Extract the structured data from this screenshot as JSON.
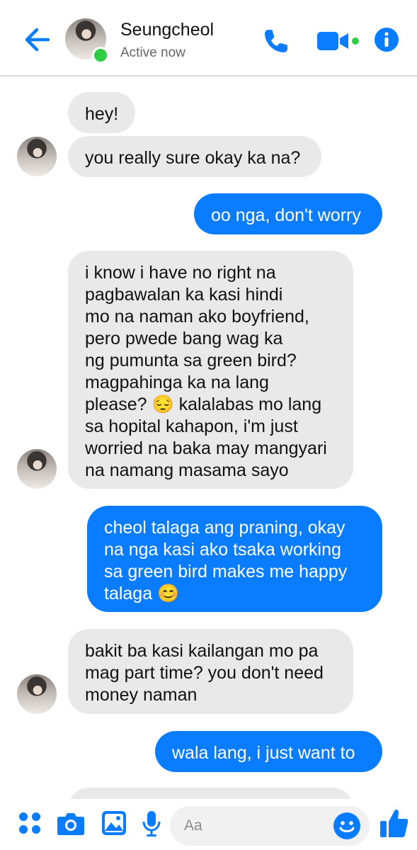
{
  "header": {
    "contact_name": "Seungcheol",
    "status": "Active now",
    "accent": "#0a7cff",
    "icons": [
      "back-arrow-icon",
      "phone-icon",
      "video-camera-icon",
      "info-icon"
    ]
  },
  "messages": [
    {
      "from": "them",
      "text": "hey!"
    },
    {
      "from": "them",
      "text": "you really sure okay ka na?"
    },
    {
      "from": "me",
      "text": "oo nga, don't worry"
    },
    {
      "from": "them",
      "text": "i know i have no right na\npagbawalan ka kasi hindi\nmo na naman ako boyfriend,\npero pwede bang wag ka\nng pumunta sa green bird?\nmagpahinga ka na lang\nplease? 😔 kalalabas mo lang\nsa hopital kahapon, i'm just\nworried na baka may mangyari\nna namang masama sayo"
    },
    {
      "from": "me",
      "text": "cheol talaga ang praning, okay\nna nga kasi ako tsaka working\nsa green bird makes me happy\ntalaga 😊"
    },
    {
      "from": "them",
      "text": "bakit ba kasi kailangan mo pa\nmag part time? you don't need\nmoney naman"
    },
    {
      "from": "me",
      "text": "wala lang, i just want to"
    }
  ],
  "composer": {
    "placeholder": "Aa",
    "icons": [
      "apps-grid-icon",
      "camera-icon",
      "gallery-icon",
      "microphone-icon",
      "emoji-icon",
      "thumbs-up-icon"
    ]
  },
  "colors": {
    "incoming_bubble": "#e9e9ea",
    "outgoing_bubble": "#0a7cff",
    "online": "#31cc46"
  }
}
